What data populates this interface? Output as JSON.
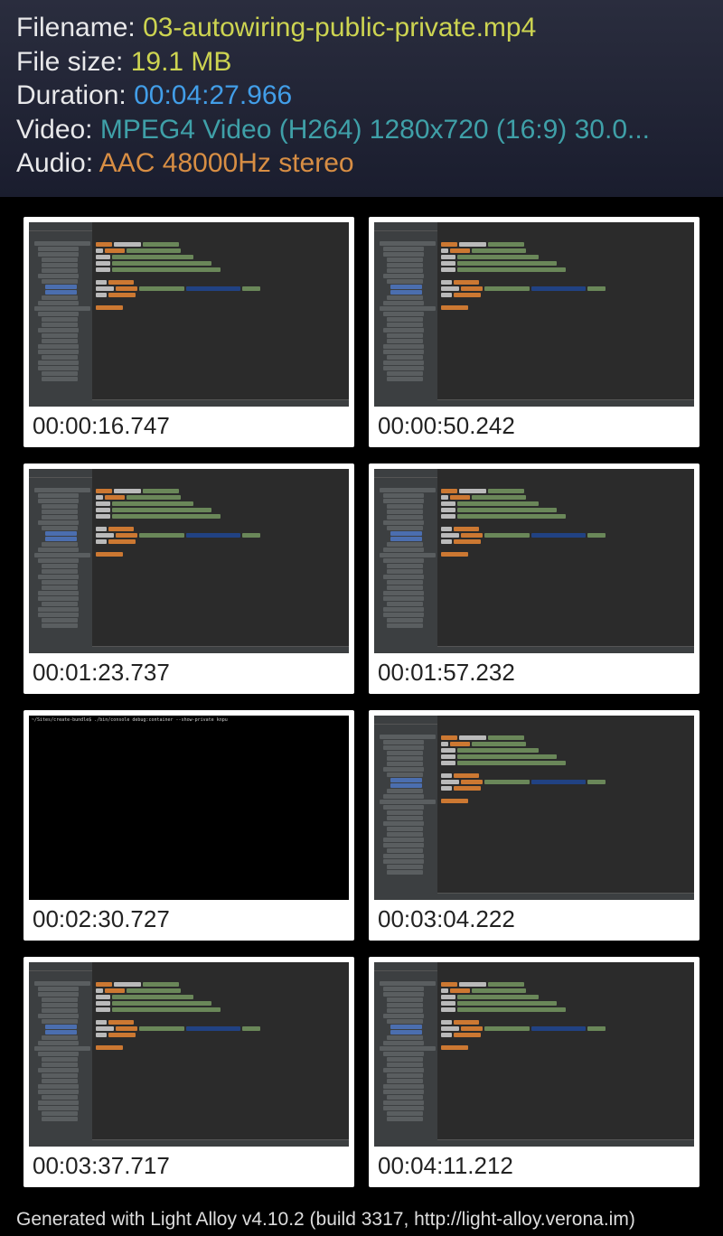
{
  "info": {
    "filename_label": "Filename: ",
    "filename_value": "03-autowiring-public-private.mp4",
    "filesize_label": "File size: ",
    "filesize_value": "19.1 MB",
    "duration_label": "Duration: ",
    "duration_value": "00:04:27.966",
    "video_label": "Video: ",
    "video_value": "MPEG4 Video (H264) 1280x720 (16:9) 30.0...",
    "audio_label": "Audio: ",
    "audio_value": "AAC 48000Hz stereo"
  },
  "thumbnails": [
    {
      "time": "00:00:16.747",
      "kind": "ide"
    },
    {
      "time": "00:00:50.242",
      "kind": "ide"
    },
    {
      "time": "00:01:23.737",
      "kind": "ide"
    },
    {
      "time": "00:01:57.232",
      "kind": "ide"
    },
    {
      "time": "00:02:30.727",
      "kind": "terminal",
      "term_text": "~/Sites/create-bundle$ ./bin/console debug:container --show-private knpu"
    },
    {
      "time": "00:03:04.222",
      "kind": "ide"
    },
    {
      "time": "00:03:37.717",
      "kind": "ide"
    },
    {
      "time": "00:04:11.212",
      "kind": "ide"
    }
  ],
  "footer": "Generated with Light Alloy v4.10.2 (build 3317, http://light-alloy.verona.im)"
}
